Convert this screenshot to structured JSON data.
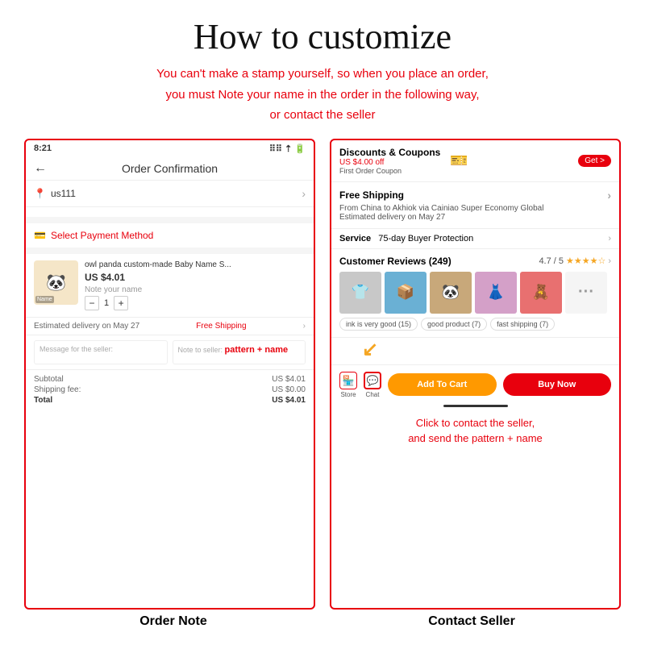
{
  "page": {
    "main_title": "How to customize",
    "subtitle_line1": "You can't make a stamp yourself, so when you place an order,",
    "subtitle_line2": "you must Note your name in the order in the following way,",
    "subtitle_line3": "or contact the seller"
  },
  "left_panel": {
    "status_time": "8:21",
    "status_icons": "⠿ ⇡ 🔋",
    "nav_back": "←",
    "nav_title": "Order Confirmation",
    "address_icon": "📍",
    "address_text": "us111",
    "chevron": ">",
    "payment_icon": "💳",
    "payment_label": "Select Payment Method",
    "product_name": "owl panda custom-made Baby Name S...",
    "product_price": "US $4.01",
    "product_note": "Note your name",
    "product_qty": "1",
    "delivery_text": "Estimated delivery on May 27",
    "free_shipping": "Free Shipping",
    "message_label": "Message for the seller:",
    "note_label": "Note to seller:",
    "note_value": "pattern + name",
    "subtotal_label": "Subtotal",
    "subtotal_value": "US $4.01",
    "shipping_label": "Shipping fee:",
    "shipping_value": "US $0.00",
    "total_label": "Total",
    "total_value": "US $4.01"
  },
  "right_panel": {
    "discount_title": "Discounts & Coupons",
    "get_label": "Get >",
    "coupon_text": "US $4.00 off",
    "coupon_sub": "First Order Coupon",
    "free_shipping_title": "Free Shipping",
    "shipping_from": "From China to Akhiok via Cainiao Super Economy Global",
    "shipping_est": "Estimated delivery on May 27",
    "service_label": "Service",
    "service_value": "75-day Buyer Protection",
    "reviews_title": "Customer Reviews (249)",
    "rating": "4.7 / 5",
    "tag1": "ink is very good (15)",
    "tag2": "good product (7)",
    "tag3": "fast shipping (7)",
    "store_label": "Store",
    "chat_label": "Chat",
    "add_to_cart": "Add To Cart",
    "buy_now": "Buy Now",
    "instruction": "Click to contact the seller,",
    "instruction2": "and send the  pattern + name"
  },
  "labels": {
    "order_note": "Order Note",
    "contact_seller": "Contact Seller"
  }
}
